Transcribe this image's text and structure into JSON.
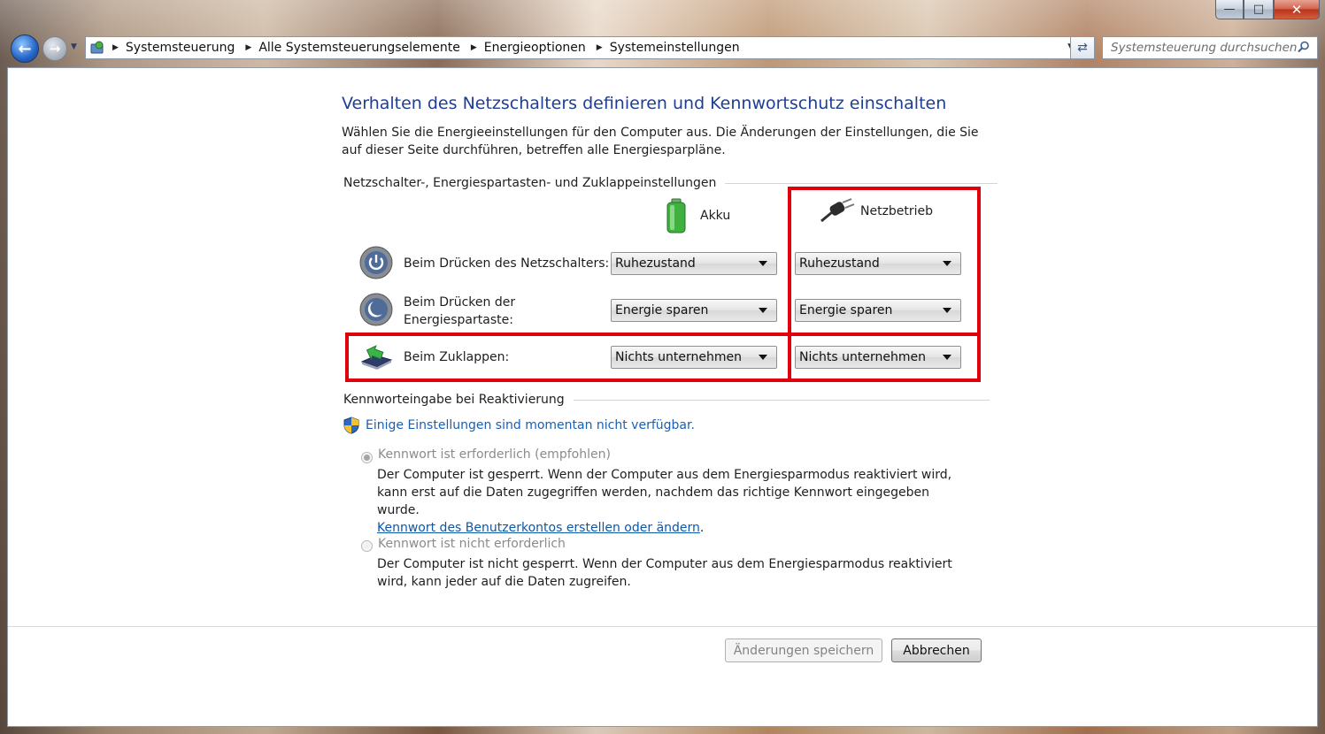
{
  "window": {
    "caption": {
      "minimize": "—",
      "maximize": "□",
      "close": "✕"
    }
  },
  "nav": {
    "breadcrumbs": [
      "Systemsteuerung",
      "Alle Systemsteuerungselemente",
      "Energieoptionen",
      "Systemeinstellungen"
    ],
    "search_placeholder": "Systemsteuerung durchsuchen"
  },
  "page": {
    "title": "Verhalten des Netzschalters definieren und Kennwortschutz einschalten",
    "description": "Wählen Sie die Energieeinstellungen für den Computer aus. Die Änderungen der Einstellungen, die Sie auf dieser Seite durchführen, betreffen alle Energiesparpläne."
  },
  "buttons_section": {
    "heading": "Netzschalter-, Energiespartasten- und Zuklappeinstellungen",
    "col_battery": "Akku",
    "col_ac": "Netzbetrieb",
    "rows": [
      {
        "label": "Beim Drücken des Netzschalters:",
        "battery": "Ruhezustand",
        "ac": "Ruhezustand"
      },
      {
        "label_line1": "Beim Drücken der",
        "label_line2": "Energiespartaste:",
        "battery": "Energie sparen",
        "ac": "Energie sparen"
      },
      {
        "label": "Beim Zuklappen:",
        "battery": "Nichts unternehmen",
        "ac": "Nichts unternehmen"
      }
    ]
  },
  "password_section": {
    "heading": "Kennworteingabe bei Reaktivierung",
    "info_link": "Einige Einstellungen sind momentan nicht verfügbar.",
    "opt_required": {
      "label": "Kennwort ist erforderlich (empfohlen)",
      "desc": "Der Computer ist gesperrt. Wenn der Computer aus dem Energiesparmodus reaktiviert wird, kann erst auf die Daten zugegriffen werden, nachdem das richtige Kennwort eingegeben wurde.",
      "link": "Kennwort des Benutzerkontos erstellen oder ändern",
      "link_suffix": "."
    },
    "opt_not_required": {
      "label": "Kennwort ist nicht erforderlich",
      "desc": "Der Computer ist nicht gesperrt. Wenn der Computer aus dem Energiesparmodus reaktiviert wird, kann jeder auf die Daten zugreifen."
    }
  },
  "footer": {
    "save": "Änderungen speichern",
    "cancel": "Abbrechen"
  },
  "colors": {
    "highlight": "#e0000b",
    "title": "#1c3f95",
    "link": "#1a5fb4"
  }
}
